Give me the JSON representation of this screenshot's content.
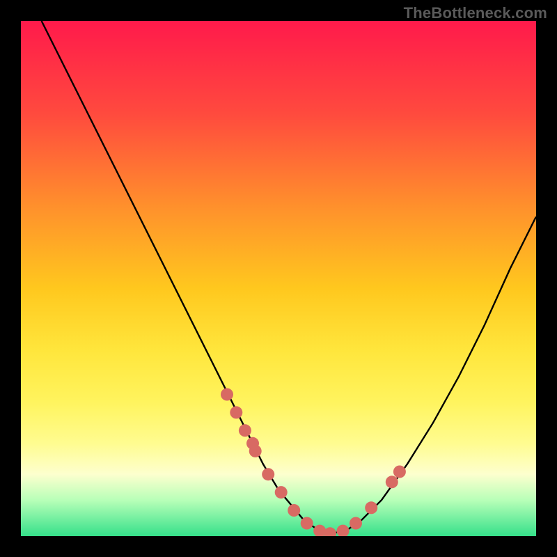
{
  "watermark": "TheBottleneck.com",
  "chart_data": {
    "type": "line",
    "title": "",
    "xlabel": "",
    "ylabel": "",
    "xlim": [
      0,
      100
    ],
    "ylim": [
      0,
      100
    ],
    "grid": false,
    "legend": false,
    "series": [
      {
        "name": "curve",
        "color": "#000000",
        "x": [
          4,
          10,
          15,
          20,
          25,
          30,
          35,
          40,
          45,
          47,
          50,
          55,
          58,
          60,
          63,
          66,
          70,
          75,
          80,
          85,
          90,
          95,
          100
        ],
        "values": [
          100,
          88,
          78,
          68,
          58,
          48,
          38,
          28,
          18,
          14,
          9,
          3,
          1,
          0.5,
          1,
          3,
          7,
          14,
          22,
          31,
          41,
          52,
          62
        ]
      }
    ],
    "markers": {
      "name": "dots",
      "color": "#d86a63",
      "radius_px": 9,
      "x": [
        40.0,
        41.8,
        43.5,
        45.0,
        45.5,
        48.0,
        50.5,
        53.0,
        55.5,
        58.0,
        60.0,
        62.5,
        65.0,
        68.0,
        72.0,
        73.5
      ],
      "values": [
        27.5,
        24.0,
        20.5,
        18.0,
        16.5,
        12.0,
        8.5,
        5.0,
        2.5,
        1.0,
        0.5,
        1.0,
        2.5,
        5.5,
        10.5,
        12.5
      ]
    },
    "background": {
      "type": "vertical-gradient",
      "stops": [
        {
          "pos": 0.0,
          "color": "#ff1a4b"
        },
        {
          "pos": 0.18,
          "color": "#ff4a3e"
        },
        {
          "pos": 0.36,
          "color": "#ff902c"
        },
        {
          "pos": 0.52,
          "color": "#ffc81e"
        },
        {
          "pos": 0.64,
          "color": "#ffe63c"
        },
        {
          "pos": 0.74,
          "color": "#fff45e"
        },
        {
          "pos": 0.82,
          "color": "#fffc90"
        },
        {
          "pos": 0.88,
          "color": "#fdffce"
        },
        {
          "pos": 0.93,
          "color": "#b8ffb8"
        },
        {
          "pos": 1.0,
          "color": "#35e08a"
        }
      ]
    }
  }
}
